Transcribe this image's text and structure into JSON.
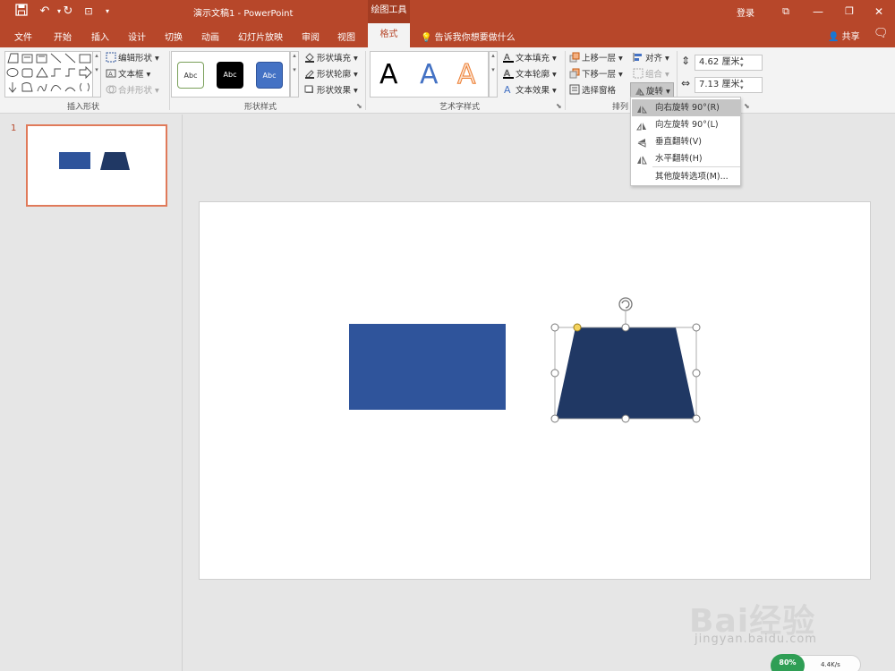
{
  "titlebar": {
    "doc_title": "演示文稿1  -  PowerPoint",
    "tools_tab_header": "绘图工具",
    "login": "登录"
  },
  "tabs": [
    "文件",
    "开始",
    "插入",
    "设计",
    "切换",
    "动画",
    "幻灯片放映",
    "审阅",
    "视图"
  ],
  "active_tab": "格式",
  "tell_me": "告诉我你想要做什么",
  "share": "共享",
  "ribbon": {
    "insert_shapes": {
      "label": "插入形状",
      "edit_shape": "编辑形状",
      "text_box": "文本框",
      "merge_shapes": "合并形状"
    },
    "shape_styles": {
      "label": "形状样式",
      "swatch_text": "Abc",
      "fill": "形状填充",
      "outline": "形状轮廓",
      "effects": "形状效果"
    },
    "wordart_styles": {
      "label": "艺术字样式",
      "glyph": "A",
      "text_fill": "文本填充",
      "text_outline": "文本轮廓",
      "text_effects": "文本效果"
    },
    "arrange": {
      "label": "排列",
      "bring_forward": "上移一层",
      "send_backward": "下移一层",
      "selection_pane": "选择窗格",
      "align": "对齐",
      "group": "组合",
      "rotate": "旋转"
    },
    "size": {
      "height": "4.62 厘米",
      "width": "7.13 厘米"
    }
  },
  "rotate_menu": {
    "items": [
      "向右旋转 90°(R)",
      "向左旋转 90°(L)",
      "垂直翻转(V)",
      "水平翻转(H)"
    ],
    "more": "其他旋转选项(M)..."
  },
  "thumbnail": {
    "number": "1"
  },
  "watermark": {
    "brand": "Bai经验",
    "url": "jingyan.baidu.com"
  },
  "speed_widget": {
    "percent": "80%",
    "rate": "4.4K/s"
  },
  "colors": {
    "accent": "#b7472a",
    "rectangle": "#2f549b",
    "trapezoid": "#203864"
  }
}
